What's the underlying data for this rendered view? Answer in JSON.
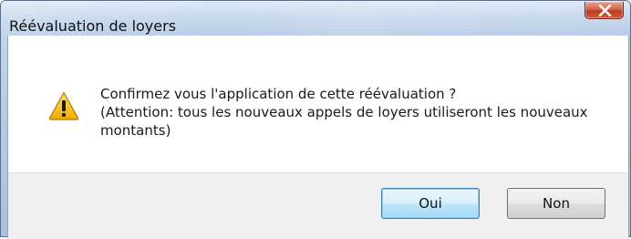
{
  "dialog": {
    "title": "Réévaluation de loyers",
    "icon": "warning-icon",
    "message_lines": [
      "Confirmez vous l'application de cette réévaluation ?",
      "(Attention: tous les nouveaux appels de loyers utiliseront les nouveaux",
      "montants)"
    ],
    "buttons": {
      "yes": "Oui",
      "no": "Non"
    },
    "default_button": "yes"
  },
  "colors": {
    "close_button": "#c9452b",
    "warning_fill": "#f6c12c",
    "default_button_border": "#3c7fb1"
  }
}
